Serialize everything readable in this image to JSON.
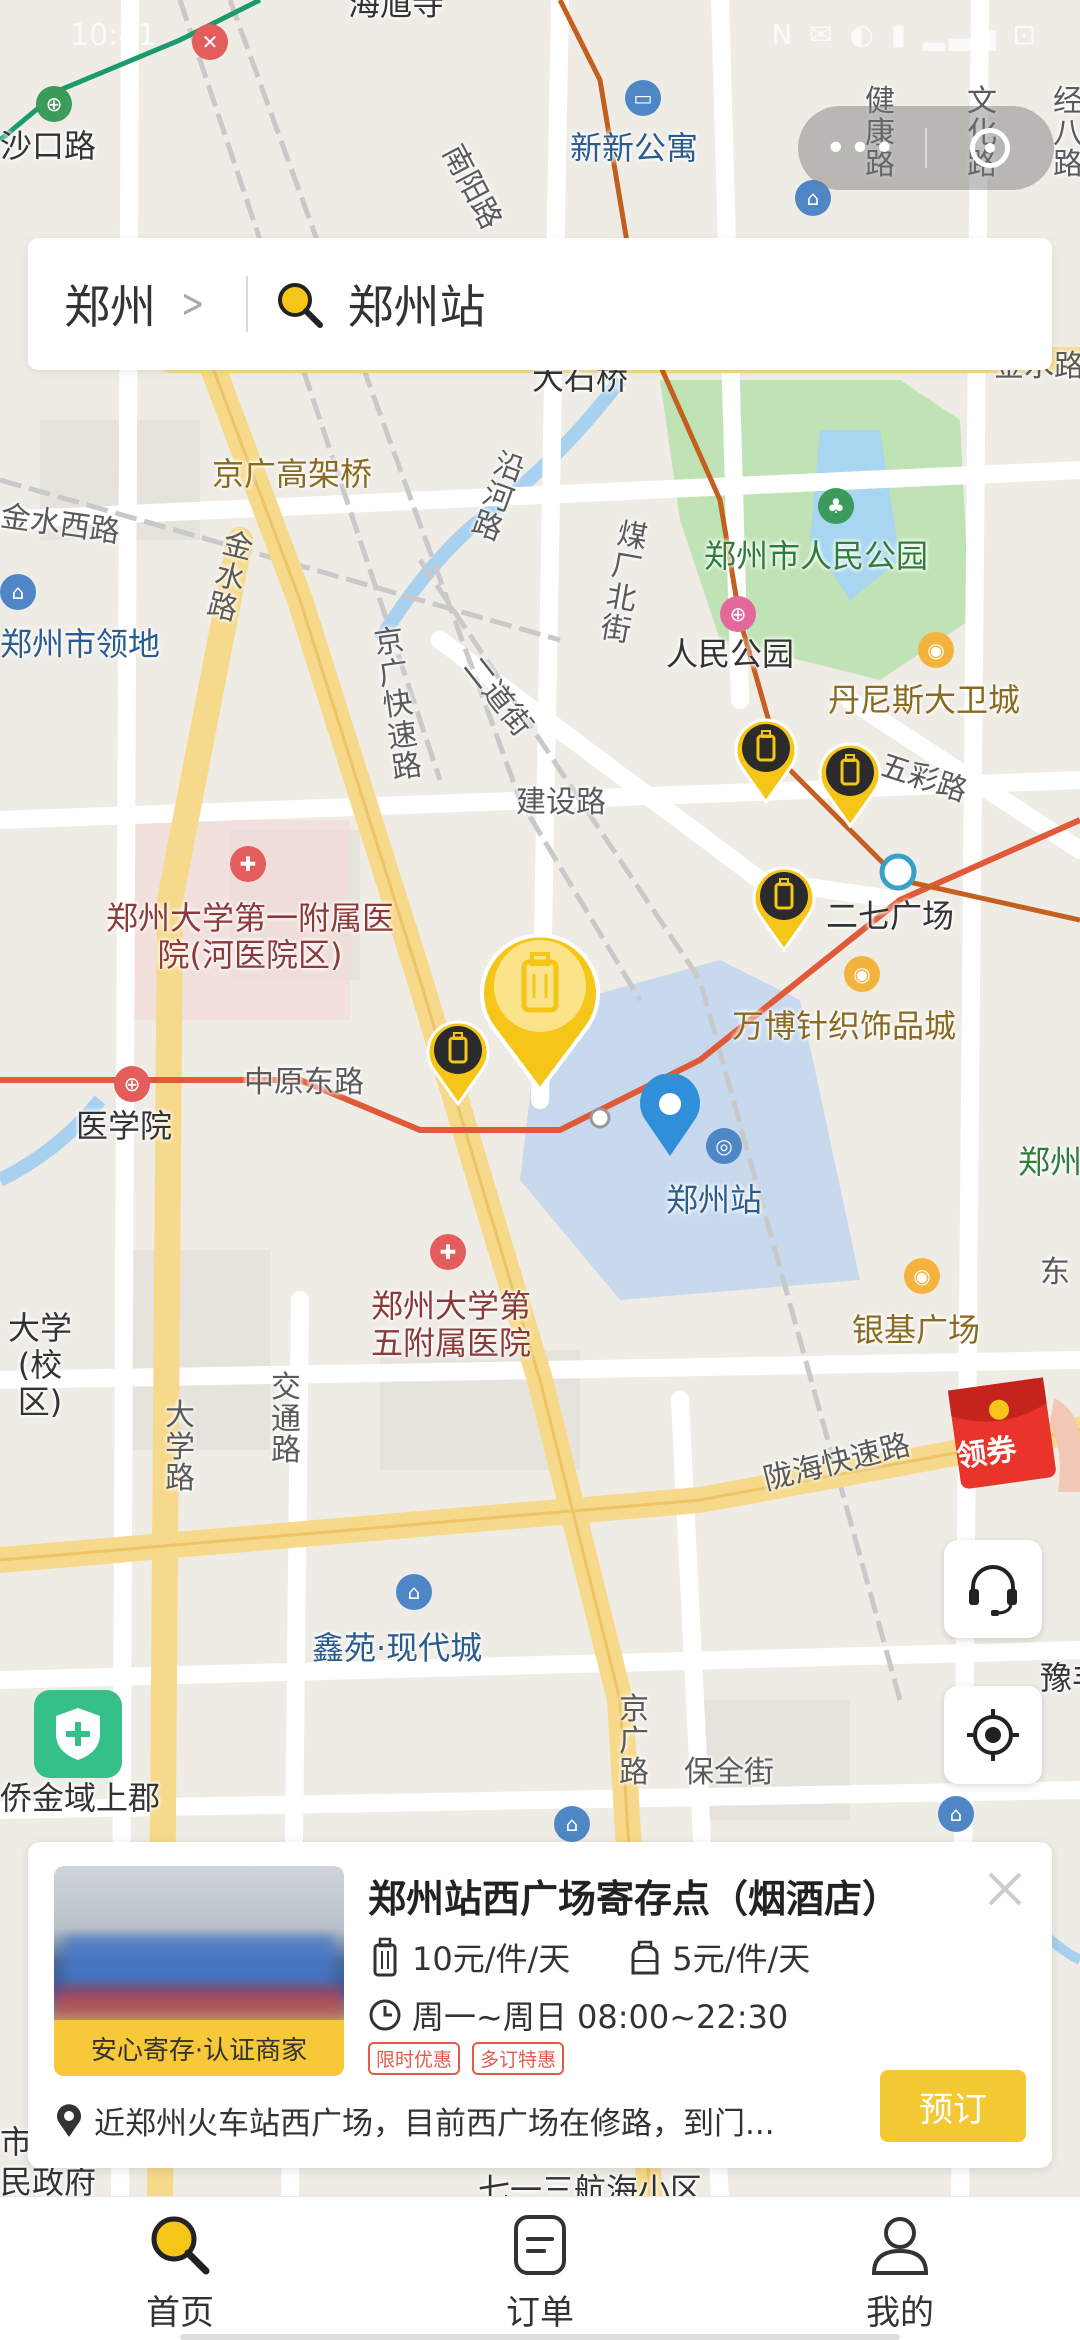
{
  "status": {
    "time": "10:41",
    "icons": "N ✉ ◐ ▮ ▂▃▅ ⊡"
  },
  "search": {
    "city": "郑州",
    "chevron": ">",
    "keyword": "郑州站"
  },
  "map_labels": {
    "haiyu": "海馗寺",
    "shakou": "沙口路",
    "xinxin": "新新公寓",
    "jiankang": "健康路",
    "wenhua": "文化路",
    "jingba": "经八路",
    "nanyang": "南阳路",
    "dashiqiao": "大石桥",
    "jinshui_r": "金水路",
    "jingguang_gj": "京广高架桥",
    "jinshui_xi": "金水西路",
    "jinshui_v": "金水路",
    "yanhe": "沿河路",
    "meichang": "煤厂北街",
    "renmin_park": "郑州市人民公园",
    "renmin": "人民公园",
    "dennis": "丹尼斯大卫城",
    "lingdi": "郑州市领地",
    "jingguang_ks": "京广快速路",
    "erdao": "二道街",
    "wucai": "五彩路",
    "jianshe": "建设路",
    "zdyfy": "郑州大学第一附属医院(河医院区)",
    "erqi": "二七广场",
    "wanbo": "万博针织饰品城",
    "zhongyuan": "中原东路",
    "yixueyuan": "医学院",
    "zhengzhou_station": "郑州站",
    "zdwfy": "郑州大学第五附属医院",
    "daxue_l": "大学(校区)",
    "dong": "东",
    "yinji": "银基广场",
    "jiaotong": "交通路",
    "daxue_r": "大学路",
    "longhai": "陇海快速路",
    "xinyuan": "鑫苑·现代城",
    "jingguang_r": "京广路",
    "baoquan": "保全街",
    "qiaojin": "侨金域上郡",
    "yufeng": "豫丰",
    "zhengzhou_e": "郑州",
    "minzhengfu": "民政府",
    "hanghai": "七一三航海小区",
    "shi": "市"
  },
  "coupon": {
    "label": "领券"
  },
  "card": {
    "title": "郑州站西广场寄存点（烟酒店）",
    "badge": "安心寄存·认证商家",
    "price_large": "10元/件/天",
    "price_small": "5元/件/天",
    "hours": "周一~周日 08:00~22:30",
    "tags": [
      "限时优惠",
      "多订特惠"
    ],
    "address": "近郑州火车站西广场，目前西广场在修路，到门...",
    "book_label": "预订"
  },
  "tabs": [
    {
      "label": "首页",
      "icon": "search-icon"
    },
    {
      "label": "订单",
      "icon": "order-icon"
    },
    {
      "label": "我的",
      "icon": "user-icon"
    }
  ],
  "colors": {
    "accent": "#f2c935",
    "marker": "#f5c518",
    "route_red": "#e05a3a",
    "highway": "#f6d98a"
  }
}
